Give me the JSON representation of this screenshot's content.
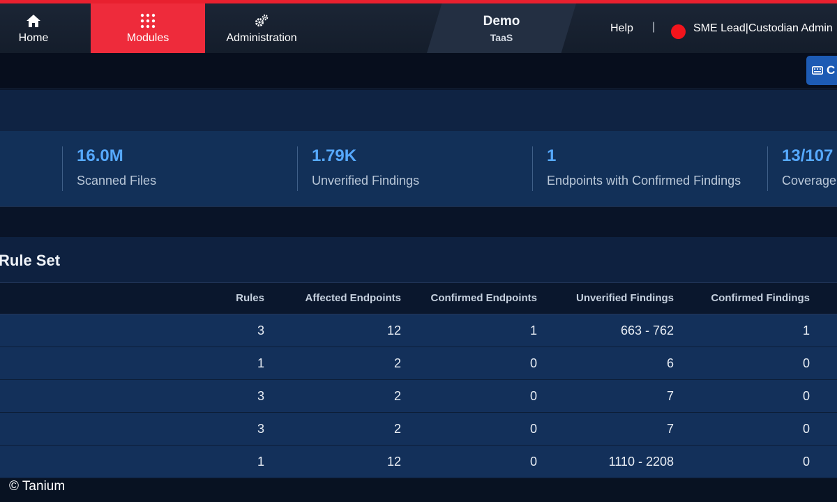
{
  "nav": {
    "home_label": "Home",
    "modules_label": "Modules",
    "admin_label": "Administration",
    "active": "Modules"
  },
  "demo": {
    "title": "Demo",
    "subtitle": "TaaS"
  },
  "header": {
    "help_label": "Help",
    "separator": "|",
    "user_label": "SME Lead|Custodian Admin"
  },
  "subbar": {
    "button_label": "C"
  },
  "stats": [
    {
      "value": "16.0M",
      "label": "Scanned Files"
    },
    {
      "value": "1.79K",
      "label": "Unverified Findings"
    },
    {
      "value": "1",
      "label": "Endpoints with Confirmed Findings"
    },
    {
      "value": "13/107",
      "label": "Coverage"
    }
  ],
  "table": {
    "title": "Rule Set",
    "columns": [
      "Rules",
      "Affected Endpoints",
      "Confirmed Endpoints",
      "Unverified Findings",
      "Confirmed Findings"
    ],
    "rows": [
      [
        "3",
        "12",
        "1",
        "663 - 762",
        "1"
      ],
      [
        "1",
        "2",
        "0",
        "6",
        "0"
      ],
      [
        "3",
        "2",
        "0",
        "7",
        "0"
      ],
      [
        "3",
        "2",
        "0",
        "7",
        "0"
      ],
      [
        "1",
        "12",
        "0",
        "1110 - 2208",
        "0"
      ]
    ]
  },
  "footer": {
    "copyright": "© Tanium"
  },
  "colors": {
    "accent": "#ee2b3b",
    "stat_value": "#56a9ff",
    "status_dot": "#f2141c",
    "button": "#1d5bb4"
  }
}
